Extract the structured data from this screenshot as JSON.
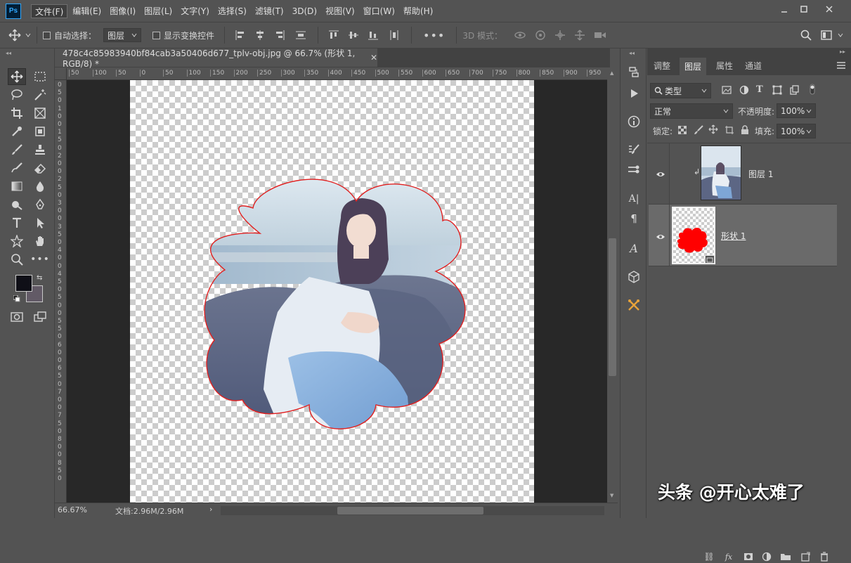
{
  "app": {
    "logo": "Ps",
    "menu": [
      "文件(F)",
      "编辑(E)",
      "图像(I)",
      "图层(L)",
      "文字(Y)",
      "选择(S)",
      "滤镜(T)",
      "3D(D)",
      "视图(V)",
      "窗口(W)",
      "帮助(H)"
    ]
  },
  "options": {
    "auto_select_label": "自动选择：",
    "auto_select_target": "图层",
    "show_transform_label": "显示变换控件",
    "mode_3d_label": "3D 模式："
  },
  "document": {
    "tab_title": "478c4c85983940bf84cab3a50406d677_tplv-obj.jpg @ 66.7% (形状 1, RGB/8) *",
    "zoom": "66.67%",
    "doc_size": "文档:2.96M/2.96M"
  },
  "ruler": {
    "h_labels": [
      "50",
      "100",
      "50",
      "0",
      "50",
      "100",
      "150",
      "200",
      "250",
      "300",
      "350",
      "400",
      "450",
      "500",
      "550",
      "600",
      "650",
      "700",
      "750",
      "800",
      "850",
      "900",
      "950"
    ],
    "v_labels": [
      "0",
      "5",
      "0",
      "1",
      "0",
      "0",
      "1",
      "5",
      "0",
      "2",
      "0",
      "0",
      "2",
      "5",
      "0",
      "3",
      "0",
      "0",
      "3",
      "5",
      "0",
      "4",
      "0",
      "0",
      "4",
      "5",
      "0",
      "5",
      "0",
      "0",
      "5",
      "5",
      "0",
      "6",
      "0",
      "0",
      "6",
      "5",
      "0",
      "7",
      "0",
      "0",
      "7",
      "5",
      "0",
      "8",
      "0",
      "0",
      "8",
      "5",
      "0"
    ]
  },
  "panel": {
    "tabs": [
      "调整",
      "图层",
      "属性",
      "通道"
    ],
    "filter_kind": "类型",
    "blend_mode": "正常",
    "opacity_label": "不透明度:",
    "opacity_value": "100%",
    "lock_label": "锁定:",
    "fill_label": "填充:",
    "fill_value": "100%",
    "layers": [
      {
        "name": "图层 1"
      },
      {
        "name": "形状 1"
      }
    ]
  },
  "watermark": "头条 @开心太难了",
  "colors": {
    "foreground": "#0f0f17",
    "background": "#625a66",
    "shape_fill": "#ff0000",
    "shape_outline": "#e02020"
  }
}
